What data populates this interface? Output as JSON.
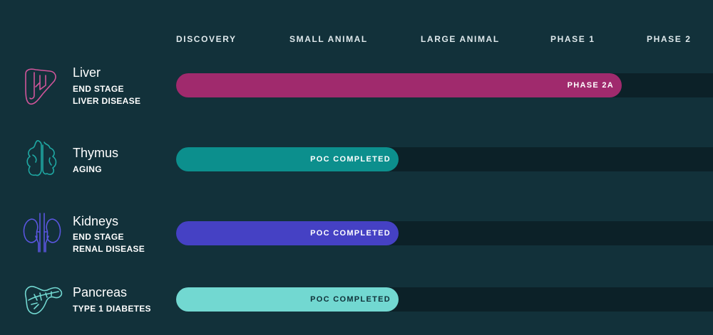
{
  "chart_data": {
    "type": "bar",
    "stages": [
      "DISCOVERY",
      "SMALL ANIMAL",
      "LARGE ANIMAL",
      "PHASE 1",
      "PHASE 2"
    ],
    "programs": [
      {
        "organ": "Liver",
        "condition": [
          "END STAGE",
          "LIVER DISEASE"
        ],
        "status": "PHASE 2A",
        "progress": 0.83,
        "color": "#a02a6d",
        "label_color": "#ffffff",
        "icon": "liver-icon",
        "icon_color": "#d0559a"
      },
      {
        "organ": "Thymus",
        "condition": [
          "AGING"
        ],
        "status": "POC COMPLETED",
        "progress": 0.415,
        "color": "#0c8f8d",
        "label_color": "#ffffff",
        "icon": "thymus-icon",
        "icon_color": "#1fa8a3"
      },
      {
        "organ": "Kidneys",
        "condition": [
          "END STAGE",
          "RENAL DISEASE"
        ],
        "status": "POC COMPLETED",
        "progress": 0.415,
        "color": "#4541c4",
        "label_color": "#ffffff",
        "icon": "kidneys-icon",
        "icon_color": "#5a56e0"
      },
      {
        "organ": "Pancreas",
        "condition": [
          "TYPE 1 DIABETES"
        ],
        "status": "POC COMPLETED",
        "progress": 0.415,
        "color": "#72d8d1",
        "label_color": "#0f3038",
        "icon": "pancreas-icon",
        "icon_color": "#72d8d1"
      }
    ]
  }
}
